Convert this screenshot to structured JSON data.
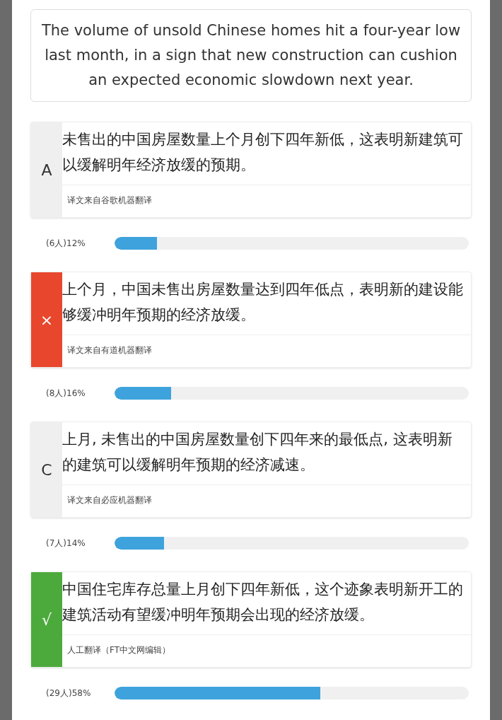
{
  "question": "The volume of unsold Chinese homes hit a four-year low last month, in a sign that new construction can cushion an expected economic slowdown next year.",
  "options": [
    {
      "kind": "letter",
      "marker": "A",
      "text": "未售出的中国房屋数量上个月创下四年新低，这表明新建筑可以缓解明年经济放缓的预期。",
      "source": "译文来自谷歌机器翻译",
      "votes": "(6人)12%",
      "level": 0.12
    },
    {
      "kind": "wrong",
      "marker": "×",
      "text": "上个月，中国未售出房屋数量达到四年低点，表明新的建设能够缓冲明年预期的经济放缓。",
      "source": "译文来自有道机器翻译",
      "votes": "(8人)16%",
      "level": 0.16
    },
    {
      "kind": "letter",
      "marker": "C",
      "text": "上月, 未售出的中国房屋数量创下四年来的最低点, 这表明新的建筑可以缓解明年预期的经济减速。",
      "source": "译文来自必应机器翻译",
      "votes": "(7人)14%",
      "level": 0.14
    },
    {
      "kind": "right",
      "marker": "√",
      "text": "中国住宅库存总量上月创下四年新低，这个迹象表明新开工的建筑活动有望缓冲明年预期会出现的经济放缓。",
      "source": "人工翻译（FT中文网编辑）",
      "votes": "(29人)58%",
      "level": 0.58
    }
  ]
}
